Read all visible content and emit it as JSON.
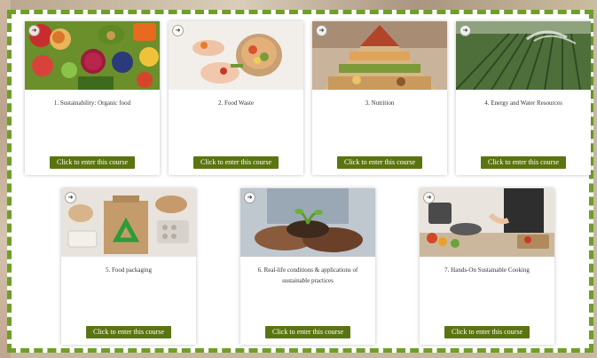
{
  "courses": [
    {
      "title": "1. Sustainability: Organic food",
      "button": "Click to enter this course",
      "icon": "organic-food-image"
    },
    {
      "title": "2. Food Waste",
      "button": "Click to enter this course",
      "icon": "food-waste-image"
    },
    {
      "title": "3. Nutrition",
      "button": "Click to enter this course",
      "icon": "nutrition-pyramid-image"
    },
    {
      "title": "4. Energy and Water Resources",
      "button": "Click to enter this course",
      "icon": "irrigation-field-image"
    },
    {
      "title": "5. Food packaging",
      "button": "Click to enter this course",
      "icon": "recycle-packaging-image"
    },
    {
      "title": "6. Real-life conditions & applications of sustainable practices",
      "button": "Click to enter this course",
      "icon": "hands-soil-seedling-image"
    },
    {
      "title": "7. Hands-On Sustainable Cooking",
      "button": "Click to enter this course",
      "icon": "cooking-kitchen-image"
    }
  ],
  "colors": {
    "frame_border": "#6f9e2a",
    "button_bg": "#5b7412",
    "button_text": "#ffffff"
  }
}
